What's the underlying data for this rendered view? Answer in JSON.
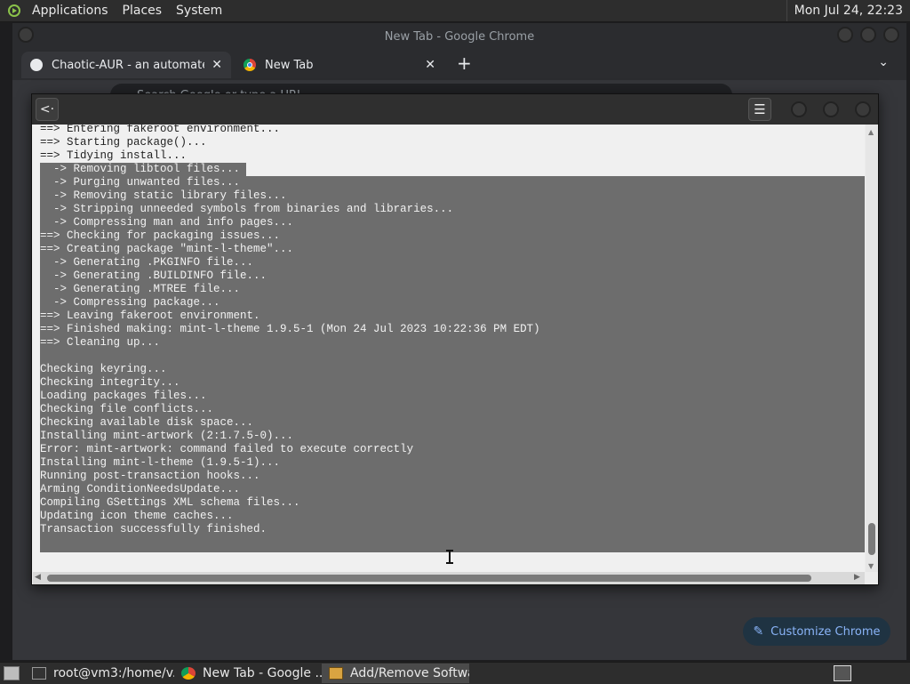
{
  "top_panel": {
    "menus": [
      "Applications",
      "Places",
      "System"
    ],
    "clock": "Mon Jul 24, 22:23"
  },
  "chrome": {
    "window_title": "New Tab - Google Chrome",
    "tabs": [
      {
        "label": "Chaotic-AUR - an automated b",
        "active": true
      },
      {
        "label": "New Tab",
        "active": false
      }
    ],
    "omnibox_placeholder": "Search Google or type a URL",
    "customize_label": "Customize Chrome"
  },
  "dialog": {
    "lines": [
      {
        "text": "==> Entering fakeroot environment...",
        "selected": false
      },
      {
        "text": "==> Starting package()...",
        "selected": false
      },
      {
        "text": "==> Tidying install...",
        "selected": false
      },
      {
        "text": "  -> Removing libtool files...",
        "selected": true
      },
      {
        "text": "  -> Purging unwanted files...",
        "selected": true
      },
      {
        "text": "  -> Removing static library files...",
        "selected": true
      },
      {
        "text": "  -> Stripping unneeded symbols from binaries and libraries...",
        "selected": true
      },
      {
        "text": "  -> Compressing man and info pages...",
        "selected": true
      },
      {
        "text": "==> Checking for packaging issues...",
        "selected": true
      },
      {
        "text": "==> Creating package \"mint-l-theme\"...",
        "selected": true
      },
      {
        "text": "  -> Generating .PKGINFO file...",
        "selected": true
      },
      {
        "text": "  -> Generating .BUILDINFO file...",
        "selected": true
      },
      {
        "text": "  -> Generating .MTREE file...",
        "selected": true
      },
      {
        "text": "  -> Compressing package...",
        "selected": true
      },
      {
        "text": "==> Leaving fakeroot environment.",
        "selected": true
      },
      {
        "text": "==> Finished making: mint-l-theme 1.9.5-1 (Mon 24 Jul 2023 10:22:36 PM EDT)",
        "selected": true
      },
      {
        "text": "==> Cleaning up...",
        "selected": true
      },
      {
        "text": "",
        "selected": true
      },
      {
        "text": "Checking keyring...",
        "selected": true
      },
      {
        "text": "Checking integrity...",
        "selected": true
      },
      {
        "text": "Loading packages files...",
        "selected": true
      },
      {
        "text": "Checking file conflicts...",
        "selected": true
      },
      {
        "text": "Checking available disk space...",
        "selected": true
      },
      {
        "text": "Installing mint-artwork (2:1.7.5-0)...",
        "selected": true
      },
      {
        "text": "Error: mint-artwork: command failed to execute correctly",
        "selected": true
      },
      {
        "text": "Installing mint-l-theme (1.9.5-1)...",
        "selected": true
      },
      {
        "text": "Running post-transaction hooks...",
        "selected": true
      },
      {
        "text": "Arming ConditionNeedsUpdate...",
        "selected": true
      },
      {
        "text": "Compiling GSettings XML schema files...",
        "selected": true
      },
      {
        "text": "Updating icon theme caches...",
        "selected": true
      },
      {
        "text": "Transaction successfully finished.",
        "selected": true
      }
    ]
  },
  "taskbar": {
    "tasks": [
      {
        "label": "root@vm3:/home/v...",
        "icon": "terminal-icon",
        "active": false
      },
      {
        "label": "New Tab - Google ...",
        "icon": "chrome-icon",
        "active": false
      },
      {
        "label": "Add/Remove Software",
        "icon": "package-icon",
        "active": true
      }
    ]
  },
  "colors": {
    "selection": "#6d6d6d",
    "terminal_bg": "#f0f0f0",
    "accent_link": "#8ab4f8"
  }
}
